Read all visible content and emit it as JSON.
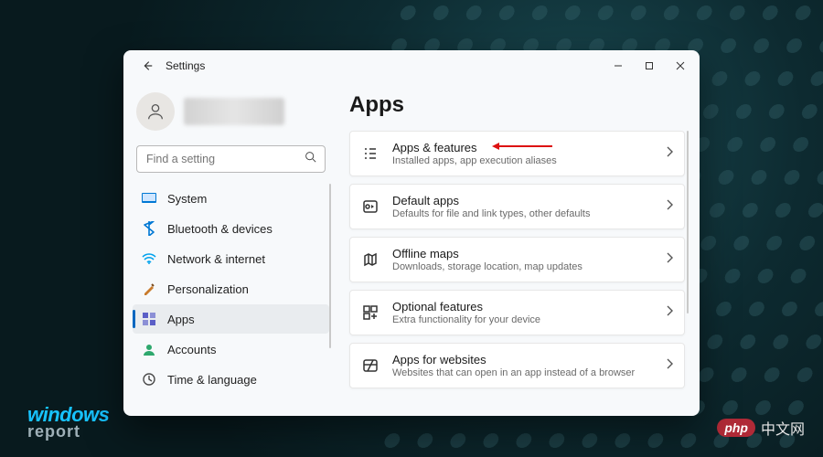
{
  "window": {
    "title": "Settings",
    "page_heading": "Apps"
  },
  "search": {
    "placeholder": "Find a setting"
  },
  "sidebar": {
    "items": [
      {
        "label": "System",
        "icon": "system",
        "selected": false
      },
      {
        "label": "Bluetooth & devices",
        "icon": "bluetooth",
        "selected": false
      },
      {
        "label": "Network & internet",
        "icon": "network",
        "selected": false
      },
      {
        "label": "Personalization",
        "icon": "personalize",
        "selected": false
      },
      {
        "label": "Apps",
        "icon": "apps",
        "selected": true
      },
      {
        "label": "Accounts",
        "icon": "accounts",
        "selected": false
      },
      {
        "label": "Time & language",
        "icon": "time-language",
        "selected": false
      }
    ]
  },
  "cards": [
    {
      "title": "Apps & features",
      "subtitle": "Installed apps, app execution aliases",
      "icon": "apps-features",
      "annotated": true
    },
    {
      "title": "Default apps",
      "subtitle": "Defaults for file and link types, other defaults",
      "icon": "default-apps"
    },
    {
      "title": "Offline maps",
      "subtitle": "Downloads, storage location, map updates",
      "icon": "offline-maps"
    },
    {
      "title": "Optional features",
      "subtitle": "Extra functionality for your device",
      "icon": "optional-features"
    },
    {
      "title": "Apps for websites",
      "subtitle": "Websites that can open in an app instead of a browser",
      "icon": "apps-websites"
    }
  ],
  "watermarks": {
    "left_line1": "windows",
    "left_line2": "report",
    "right_badge": "php",
    "right_text": "中文网"
  },
  "icon_colors": {
    "system": "#0078d4",
    "bluetooth": "#0078d4",
    "network": "#00a2ed",
    "personalize": "#c97b2d",
    "apps": "#5b5fc7",
    "accounts": "#2ea86d",
    "time-language": "#4a4a4a"
  }
}
